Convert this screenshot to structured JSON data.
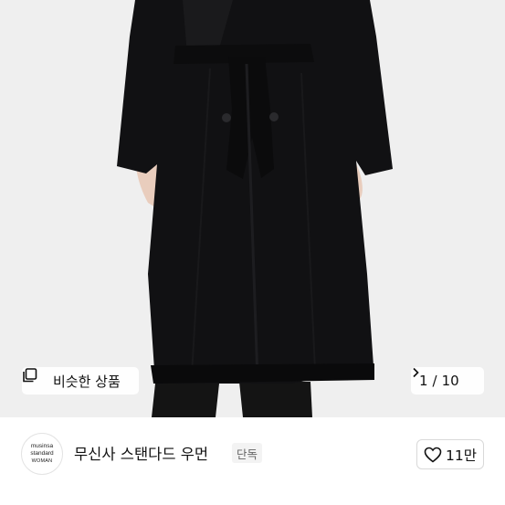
{
  "gallery": {
    "similar_label": "비슷한 상품",
    "similar_icon": "square-stack-icon",
    "counter_current": "1",
    "counter_sep": "/",
    "counter_total": "10",
    "next_icon": "chevron-right-icon"
  },
  "brand": {
    "logo_line1": "musinsa",
    "logo_line2": "standard",
    "logo_line3": "WOMAN",
    "name": "무신사 스탠다드 우먼",
    "badge": "단독"
  },
  "like": {
    "icon": "heart-outline-icon",
    "count": "11만"
  }
}
